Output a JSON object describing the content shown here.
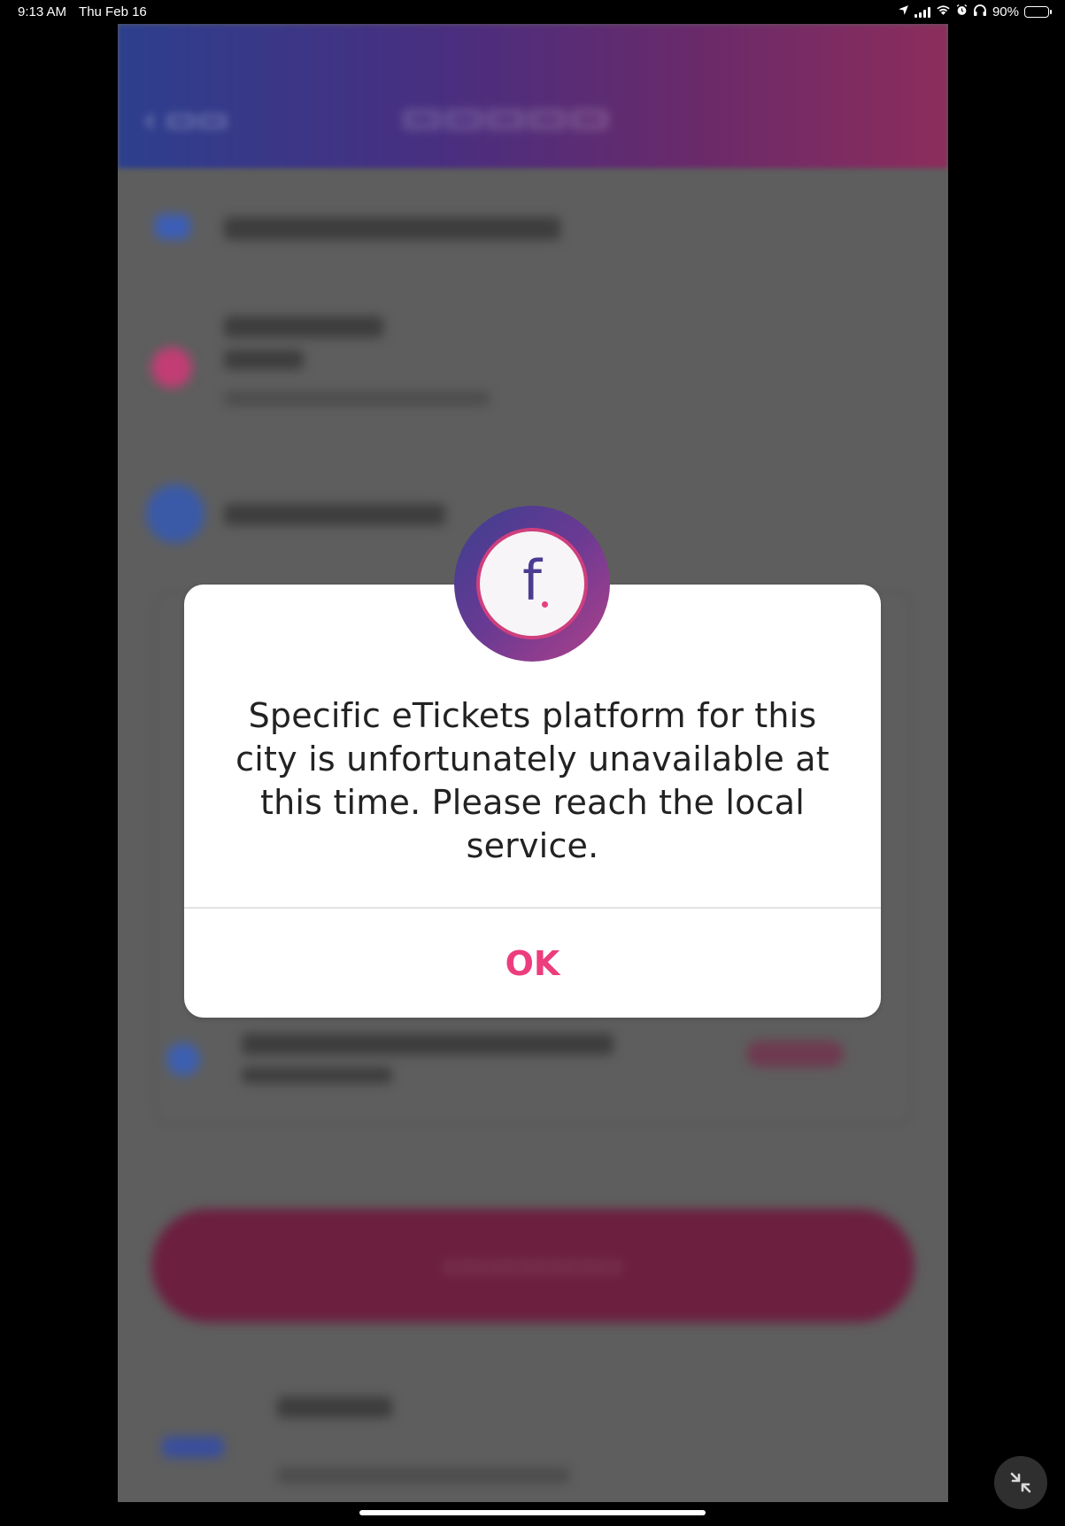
{
  "status_bar": {
    "time": "9:13 AM",
    "date": "Thu Feb 16",
    "battery_percent": "90%",
    "battery_level": 0.9,
    "icons": [
      "location-icon",
      "signal-icon",
      "wifi-icon",
      "alarm-icon",
      "headphones-icon",
      "battery-icon"
    ]
  },
  "dialog": {
    "logo_letter": "f",
    "message": "Specific eTickets platform for this city is unfortunately unavailable at this time. Please reach the local service.",
    "ok_label": "OK"
  },
  "colors": {
    "accent": "#ec3d7d",
    "header_gradient_start": "#2c3f8e",
    "header_gradient_end": "#8c2d5c",
    "logo_ring_start": "#3b3f8f",
    "logo_ring_end": "#b0408a"
  }
}
